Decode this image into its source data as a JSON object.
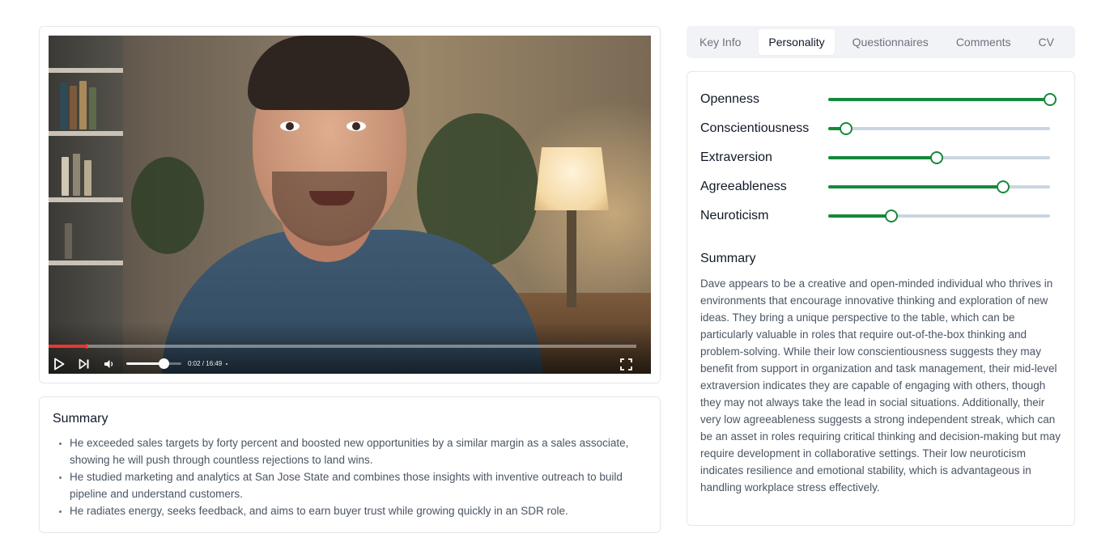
{
  "video": {
    "time_display": "0:02 / 16:49",
    "progress_fraction": 0.064,
    "volume_fraction": 0.68,
    "icons": {
      "play": "play-icon",
      "next": "skip-next-icon",
      "volume": "volume-icon",
      "fullscreen": "fullscreen-icon"
    },
    "colors": {
      "progress": "#e53935"
    }
  },
  "summary_card": {
    "title": "Summary",
    "bullets": [
      "He exceeded sales targets by forty percent and boosted new opportunities by a similar margin as a sales associate, showing he will push through countless rejections to land wins.",
      "He studied marketing and analytics at San Jose State and combines those insights with inventive outreach to build pipeline and understand customers.",
      "He radiates energy, seeks feedback, and aims to earn buyer trust while growing quickly in an SDR role."
    ]
  },
  "tabs": {
    "items": [
      "Key Info",
      "Personality",
      "Questionnaires",
      "Comments",
      "CV"
    ],
    "active": "Personality"
  },
  "personality": {
    "accent_color": "#15893b",
    "track_color": "#cbd5e1",
    "traits": [
      {
        "label": "Openness",
        "value": 1.0
      },
      {
        "label": "Conscientiousness",
        "value": 0.08
      },
      {
        "label": "Extraversion",
        "value": 0.49
      },
      {
        "label": "Agreeableness",
        "value": 0.79
      },
      {
        "label": "Neuroticism",
        "value": 0.285
      }
    ],
    "summary_title": "Summary",
    "summary_text": "Dave appears to be a creative and open-minded individual who thrives in environments that encourage innovative thinking and exploration of new ideas. They bring a unique perspective to the table, which can be particularly valuable in roles that require out-of-the-box thinking and problem-solving. While their low conscientiousness suggests they may benefit from support in organization and task management, their mid-level extraversion indicates they are capable of engaging with others, though they may not always take the lead in social situations. Additionally, their very low agreeableness suggests a strong independent streak, which can be an asset in roles requiring critical thinking and decision-making but may require development in collaborative settings. Their low neuroticism indicates resilience and emotional stability, which is advantageous in handling workplace stress effectively."
  }
}
